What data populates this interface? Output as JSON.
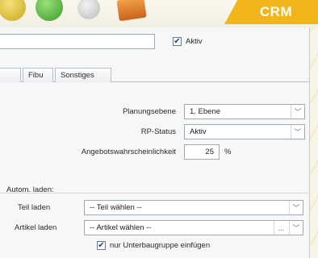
{
  "badge": {
    "label": "CRM"
  },
  "header": {
    "aktiv_label": "Aktiv",
    "aktiv_checked": true
  },
  "tabs": [
    {
      "label": "Fibu"
    },
    {
      "label": "Sonstiges"
    }
  ],
  "form": {
    "planungsebene": {
      "label": "Planungsebene",
      "value": "1. Ebene"
    },
    "rp_status": {
      "label": "RP-Status",
      "value": "Aktiv"
    },
    "angebotswahrscheinlichkeit": {
      "label": "Angebotswahrscheinlichkeit",
      "value": "25",
      "unit": "%"
    }
  },
  "auto_load": {
    "section_label": "Autom. laden:",
    "teil": {
      "label": "Teil laden",
      "value": "-- Teil wählen --"
    },
    "artikel": {
      "label": "Artikel laden",
      "value": "-- Artikel wählen --",
      "dots_label": "..."
    },
    "nur_unterbaugruppe": {
      "label": "nur Unterbaugruppe einfügen",
      "checked": true
    }
  },
  "icons": {
    "check": "✔",
    "dropdown": "﹀"
  }
}
